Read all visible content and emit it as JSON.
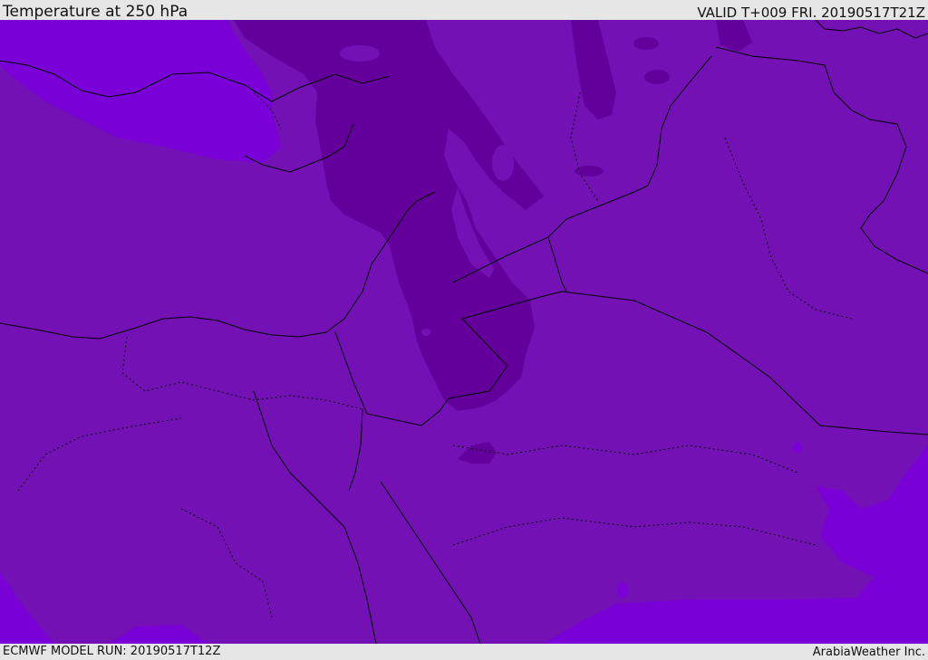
{
  "header": {
    "title": "Temperature at 250 hPa",
    "valid": "VALID T+009 FRI. 20190517T21Z"
  },
  "footer": {
    "model_run": "ECMWF MODEL RUN: 20190517T12Z",
    "credit": "ArabiaWeather Inc."
  },
  "colors": {
    "band_mid": "#7311b5",
    "band_cold": "#63009c",
    "band_warm": "#7a00d8",
    "border": "#000000",
    "frame": "#e6e6e6"
  }
}
